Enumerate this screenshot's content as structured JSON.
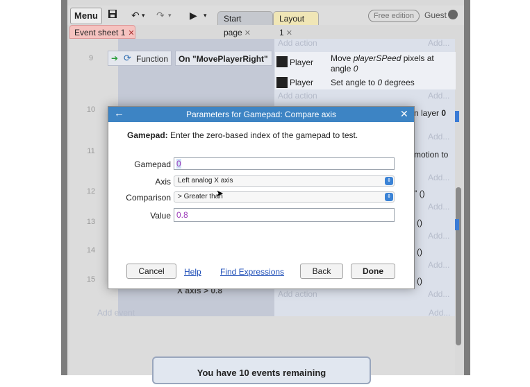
{
  "toolbar": {
    "menu_label": "Menu",
    "save_icon": "save-icon",
    "undo_icon": "undo-icon",
    "redo_icon": "redo-icon",
    "play_icon": "play-icon",
    "tabs": [
      {
        "label": "Start page"
      },
      {
        "label": "Layout 1"
      }
    ],
    "edition_label": "Free edition",
    "user_label": "Guest"
  },
  "sheet_tab": {
    "label": "Event sheet 1"
  },
  "sheet": {
    "rows": [
      {
        "num": "9"
      },
      {
        "num": "10"
      },
      {
        "num": "11"
      },
      {
        "num": "12"
      },
      {
        "num": "13"
      },
      {
        "num": "14"
      },
      {
        "num": "15"
      }
    ],
    "add_action": "Add action",
    "add_more": "Add...",
    "function_label": "Function",
    "condition_text": "On \"MovePlayerRight\"",
    "actions": [
      {
        "object": "Player",
        "text_prefix": "Move ",
        "text_var": "playerSPeed",
        "text_suffix": " pixels at",
        "text_line2": "angle ",
        "text_line2_var": "0"
      },
      {
        "object": "Player",
        "text_prefix": "Set angle to ",
        "text_var": "0",
        "text_suffix": " degrees"
      }
    ],
    "peek_texts": [
      "n layer ",
      "0",
      "motion to",
      "\" ()",
      "()",
      "()",
      "()"
    ],
    "peek_bottom": "X axis > 0.8",
    "add_event": "Add event",
    "banner": "You have 10 events remaining"
  },
  "dialog": {
    "title": "Parameters for Gamepad: Compare axis",
    "desc_bold": "Gamepad:",
    "desc_text": " Enter the zero-based index of the gamepad to test.",
    "fields": {
      "gamepad": {
        "label": "Gamepad",
        "value": "0"
      },
      "axis": {
        "label": "Axis",
        "value": "Left analog X axis"
      },
      "comparison": {
        "label": "Comparison",
        "value": "> Greater than"
      },
      "value": {
        "label": "Value",
        "value": "0.8"
      }
    },
    "buttons": {
      "cancel": "Cancel",
      "help": "Help",
      "find_expressions": "Find Expressions",
      "back": "Back",
      "done": "Done"
    }
  },
  "colors": {
    "dialog_title_bar": "#3d84c4",
    "sheet_tab": "#f5c3c0",
    "expression_purple": "#9b3ab8"
  }
}
